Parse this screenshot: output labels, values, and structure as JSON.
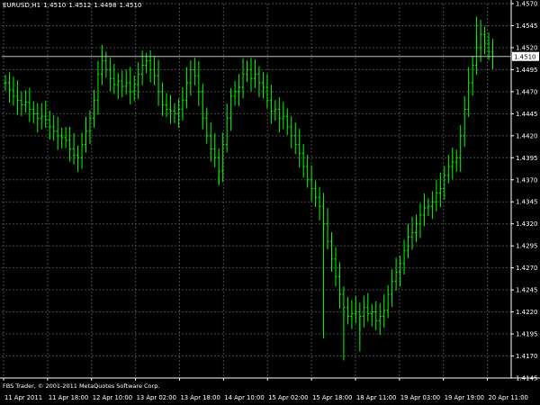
{
  "header": {
    "symbol": "EURUSD,H1",
    "open": "1.4510",
    "high": "1.4512",
    "low": "1.4498",
    "close": "1.4510"
  },
  "footer": {
    "copyright": "FBS Trader, © 2001-2011 MetaQuotes Software Corp."
  },
  "colors": {
    "background": "#000000",
    "grid": "#4a4a4a",
    "candle": "#00ff00",
    "axis_text": "#ffffff",
    "price_line": "#bfbfbf"
  },
  "chart_data": {
    "type": "line",
    "title": "EURUSD,H1",
    "grid": true,
    "y_axis_position": "right",
    "ylim": [
      1.4145,
      1.457
    ],
    "yticks": [
      "1.4570",
      "1.4545",
      "1.4520",
      "1.4495",
      "1.4470",
      "1.4445",
      "1.4420",
      "1.4395",
      "1.4370",
      "1.4345",
      "1.4320",
      "1.4295",
      "1.4270",
      "1.4245",
      "1.4220",
      "1.4195",
      "1.4170",
      "1.4145"
    ],
    "current_price_label": "1.4510",
    "current_price": 1.451,
    "xticks": [
      "11 Apr 2011",
      "11 Apr 18:00",
      "12 Apr 10:00",
      "13 Apr 02:00",
      "13 Apr 18:00",
      "14 Apr 10:00",
      "15 Apr 02:00",
      "15 Apr 18:00",
      "18 Apr 11:00",
      "19 Apr 03:00",
      "19 Apr 19:00",
      "20 Apr 11:00"
    ],
    "series": [
      {
        "name": "EURUSD,H1",
        "style": "bars",
        "values": [
          1.448,
          1.4472,
          1.4465,
          1.446,
          1.4455,
          1.4458,
          1.445,
          1.4445,
          1.444,
          1.4442,
          1.4438,
          1.443,
          1.4425,
          1.442,
          1.4418,
          1.4415,
          1.4405,
          1.4398,
          1.4395,
          1.441,
          1.4425,
          1.444,
          1.446,
          1.449,
          1.4505,
          1.4495,
          1.4485,
          1.4478,
          1.4482,
          1.4476,
          1.448,
          1.447,
          1.4478,
          1.449,
          1.45,
          1.4505,
          1.4495,
          1.4488,
          1.447,
          1.4455,
          1.445,
          1.4448,
          1.4445,
          1.445,
          1.446,
          1.448,
          1.4495,
          1.4488,
          1.447,
          1.444,
          1.442,
          1.4405,
          1.4395,
          1.438,
          1.441,
          1.444,
          1.4465,
          1.447,
          1.4475,
          1.449,
          1.4495,
          1.4485,
          1.449,
          1.448,
          1.4475,
          1.446,
          1.4448,
          1.445,
          1.444,
          1.4442,
          1.443,
          1.442,
          1.441,
          1.44,
          1.4385,
          1.437,
          1.436,
          1.435,
          1.434,
          1.432,
          1.43,
          1.428,
          1.426,
          1.424,
          1.4225,
          1.4215,
          1.4218,
          1.422,
          1.4215,
          1.4225,
          1.4218,
          1.422,
          1.421,
          1.4215,
          1.4222,
          1.424,
          1.4255,
          1.4265,
          1.4275,
          1.429,
          1.4305,
          1.431,
          1.432,
          1.433,
          1.4338,
          1.434,
          1.4345,
          1.4355,
          1.436,
          1.4375,
          1.4385,
          1.439,
          1.4395,
          1.442,
          1.445,
          1.448,
          1.45,
          1.452,
          1.4535,
          1.4525,
          1.4515,
          1.451
        ]
      }
    ]
  }
}
